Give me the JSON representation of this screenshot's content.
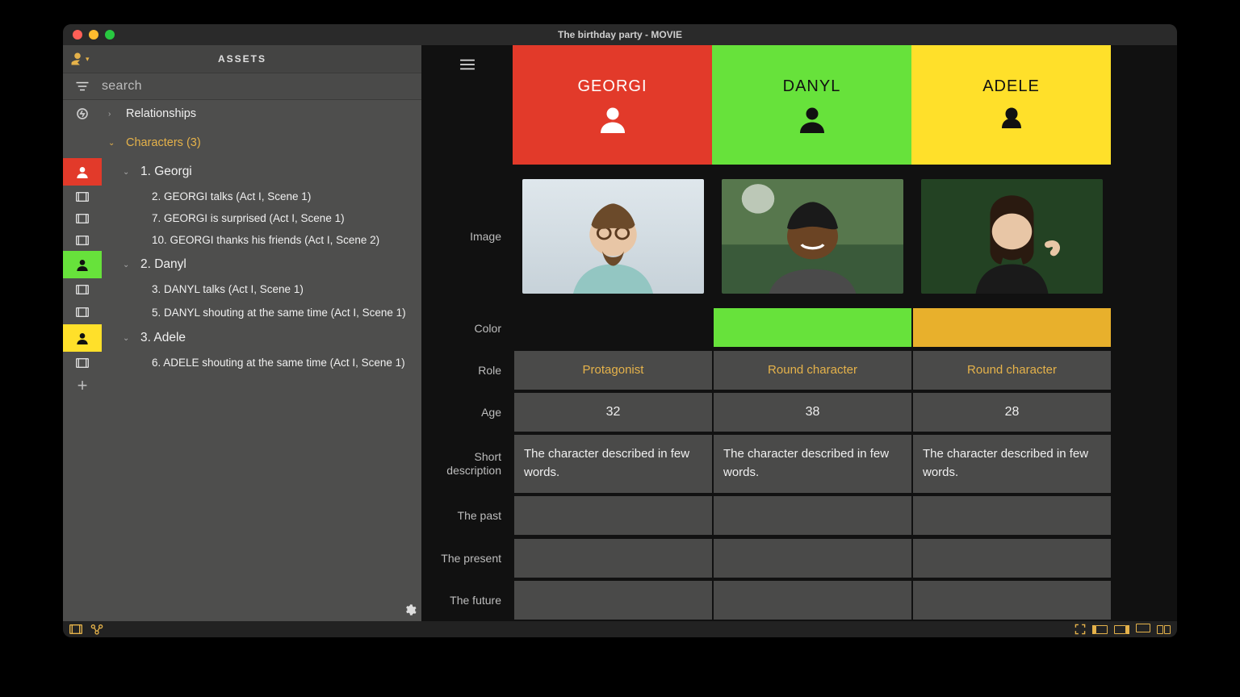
{
  "window": {
    "title": "The birthday party - MOVIE"
  },
  "sidebar": {
    "header": "ASSETS",
    "search_placeholder": "search",
    "sections": {
      "relationships_label": "Relationships",
      "characters_label": "Characters (3)"
    },
    "characters": {
      "georgi": {
        "label": "1. Georgi",
        "color": "#e23a2a",
        "scenes": [
          "2. GEORGI talks (Act I, Scene 1)",
          "7. GEORGI is surprised (Act I, Scene 1)",
          "10. GEORGI thanks his friends (Act I, Scene 2)"
        ]
      },
      "danyl": {
        "label": "2. Danyl",
        "color": "#67e23b",
        "scenes": [
          "3. DANYL talks (Act I, Scene 1)",
          "5. DANYL shouting at the same time (Act I, Scene 1)"
        ]
      },
      "adele": {
        "label": "3. Adele",
        "color": "#ffe02a",
        "scenes": [
          "6. ADELE shouting at the same time (Act I, Scene 1)"
        ]
      }
    }
  },
  "table": {
    "headers": {
      "georgi": "GEORGI",
      "danyl": "DANYL",
      "adele": "ADELE"
    },
    "row_labels": {
      "image": "Image",
      "color": "Color",
      "role": "Role",
      "age": "Age",
      "short_desc": "Short description",
      "past": "The past",
      "present": "The present",
      "future": "The future"
    },
    "colors": {
      "georgi": "#9c2e22",
      "danyl": "#67e23b",
      "adele": "#e8b02c"
    },
    "roles": {
      "georgi": "Protagonist",
      "danyl": "Round character",
      "adele": "Round character"
    },
    "ages": {
      "georgi": "32",
      "danyl": "38",
      "adele": "28"
    },
    "short": {
      "georgi": "The character described in few words.",
      "danyl": "The character described in few words.",
      "adele": "The character described in few words."
    }
  }
}
